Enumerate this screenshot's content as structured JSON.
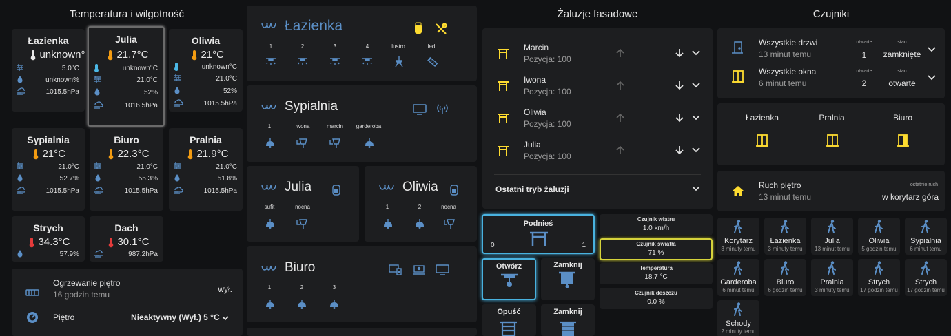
{
  "colors": {
    "blue": "#5b8fc6",
    "yellow": "#fddb30",
    "orange": "#f39c12",
    "red": "#e33b3b",
    "cyan": "#4bb8e6",
    "card": "#1d1e20",
    "bg": "#111214"
  },
  "temp": {
    "title": "Temperatura i wilgotność",
    "lazienka": {
      "name": "Łazienka",
      "value": "unknown°",
      "r1": "5.0°C",
      "r2": "unknown%",
      "r3": "1015.5hPa"
    },
    "julia": {
      "name": "Julia",
      "value": "21.7°C",
      "r0": "unknown°C",
      "r1": "21.0°C",
      "r2": "52%",
      "r3": "1016.5hPa"
    },
    "oliwia": {
      "name": "Oliwia",
      "value": "21°C",
      "r0": "unknown°C",
      "r1": "21.0°C",
      "r2": "52%",
      "r3": "1015.5hPa"
    },
    "sypialnia": {
      "name": "Sypialnia",
      "value": "21°C",
      "r1": "21.0°C",
      "r2": "52.7%",
      "r3": "1015.5hPa"
    },
    "biuro": {
      "name": "Biuro",
      "value": "22.3°C",
      "r1": "21.0°C",
      "r2": "55.3%",
      "r3": "1015.5hPa"
    },
    "pralnia": {
      "name": "Pralnia",
      "value": "21.9°C",
      "r1": "21.0°C",
      "r2": "51.8%",
      "r3": "1015.5hPa"
    },
    "strych": {
      "name": "Strych",
      "value": "34.3°C",
      "r2": "57.9%"
    },
    "dach": {
      "name": "Dach",
      "value": "30.1°C",
      "r3": "987.2hPa"
    },
    "heat": {
      "name": "Ogrzewanie piętro",
      "time": "16 godzin temu",
      "state": "wył.",
      "floor": "Piętro",
      "mode": "Nieaktywny (Wył.) 5 °C"
    }
  },
  "lights": {
    "lazienka": {
      "name": "Łazienka",
      "items": [
        "1",
        "2",
        "3",
        "4",
        "lustro",
        "led"
      ]
    },
    "sypialnia": {
      "name": "Sypialnia",
      "items": [
        "1",
        "iwona",
        "marcin",
        "garderoba"
      ]
    },
    "julia": {
      "name": "Julia",
      "items": [
        "sufit",
        "nocna"
      ]
    },
    "oliwia": {
      "name": "Oliwia",
      "items": [
        "1",
        "2",
        "nocna"
      ]
    },
    "biuro": {
      "name": "Biuro",
      "items": [
        "1",
        "2",
        "3"
      ]
    }
  },
  "blinds": {
    "title": "Żaluzje fasadowe",
    "items": [
      {
        "name": "Marcin",
        "pos": "Pozycja: 100"
      },
      {
        "name": "Iwona",
        "pos": "Pozycja: 100"
      },
      {
        "name": "Oliwia",
        "pos": "Pozycja: 100"
      },
      {
        "name": "Julia",
        "pos": "Pozycja: 100"
      }
    ],
    "last_mode": "Ostatni tryb żaluzji",
    "raise": "Podnieś",
    "raise_min": "0",
    "raise_max": "1",
    "open": "Otwórz",
    "close1": "Zamknij",
    "lower": "Opuść",
    "close2": "Zamknij",
    "wind_label": "Czujnik wiatru",
    "wind_value": "1.0 km/h",
    "light_label": "Czujnik światła",
    "light_value": "71 %",
    "temp_label": "Temperatura",
    "temp_value": "18.7 °C",
    "rain_label": "Czujnik deszczu",
    "rain_value": "0.0 %"
  },
  "sensors": {
    "title": "Czujniki",
    "doors": {
      "name": "Wszystkie drzwi",
      "time": "13 minut temu",
      "open_label": "otwarte",
      "open": "1",
      "state_label": "stan",
      "state": "zamknięte"
    },
    "windows": {
      "name": "Wszystkie okna",
      "time": "6 minut temu",
      "open_label": "otwarte",
      "open": "2",
      "state_label": "stan",
      "state": "otwarte"
    },
    "rooms": [
      "Łazienka",
      "Pralnia",
      "Biuro"
    ],
    "motion": {
      "name": "Ruch piętro",
      "time": "13 minut temu",
      "last_label": "ostatnio ruch",
      "last": "w korytarz góra"
    },
    "tiles": [
      {
        "n": "Korytarz",
        "s": "3 minuty temu"
      },
      {
        "n": "Łazienka",
        "s": "3 minuty temu"
      },
      {
        "n": "Julia",
        "s": "13 minut temu"
      },
      {
        "n": "Oliwia",
        "s": "5 godzin temu"
      },
      {
        "n": "Sypialnia",
        "s": "6 minut temu"
      },
      {
        "n": "Garderoba",
        "s": "6 minut temu"
      },
      {
        "n": "Biuro",
        "s": "6 godzin temu"
      },
      {
        "n": "Pralnia",
        "s": "3 minuty temu"
      },
      {
        "n": "Strych",
        "s": "17 godzin temu"
      },
      {
        "n": "Strych",
        "s": "17 godzin temu"
      },
      {
        "n": "Schody",
        "s": "2 minuty temu"
      }
    ]
  }
}
